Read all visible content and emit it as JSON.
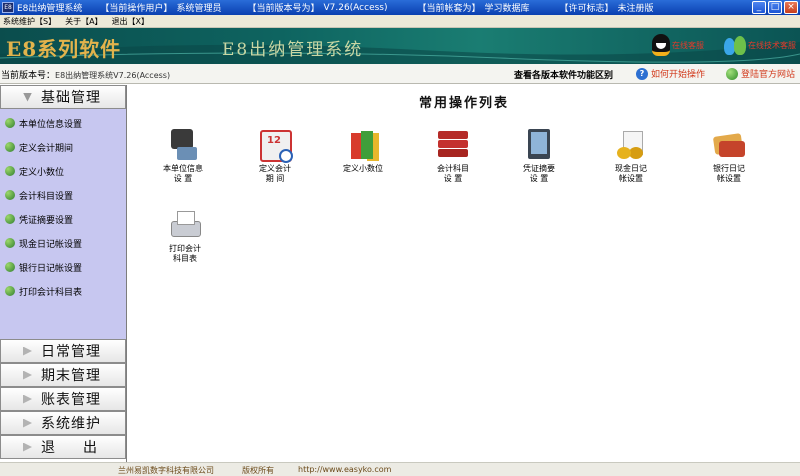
{
  "titlebar": {
    "icon_text": "E8",
    "app_name": "E8出纳管理系统",
    "operator_label": "【当前操作用户】",
    "operator_value": "系统管理员",
    "version_label": "【当前版本号为】",
    "version_value": "V7.26(Access)",
    "account_label": "【当前帐套为】",
    "account_value": "学习数据库",
    "license_label": "【许可标志】",
    "license_value": "未注册版"
  },
  "menu": {
    "items": [
      "系统维护【S】",
      "关于【A】",
      "退出【X】"
    ]
  },
  "banner": {
    "brand": "E8系列软件",
    "product": "E8出纳管理系统",
    "qq1": "在线客服",
    "qq2": "在线技术客服"
  },
  "infobar": {
    "version_label": "当前版本号：",
    "version_value": "E8出纳管理系统V7.26(Access)",
    "compare": "查看各版本软件功能区别",
    "help": "如何开始操作",
    "site": "登陆官方网站"
  },
  "nav": {
    "basic": "基础管理",
    "items": [
      "本单位信息设置",
      "定义会计期间",
      "定义小数位",
      "会计科目设置",
      "凭证摘要设置",
      "现金日记帐设置",
      "银行日记帐设置",
      "打印会计科目表"
    ],
    "daily": "日常管理",
    "period_end": "期末管理",
    "ledger": "账表管理",
    "system": "系统维护",
    "exit": "退出"
  },
  "main": {
    "title": "常用操作列表",
    "ops": [
      "本单位信息\n设  置",
      "定义会计\n期  间",
      "定义小数位",
      "会计科目\n设  置",
      "凭证摘要\n设  置",
      "现金日记\n帐设置",
      "银行日记\n帐设置",
      "打印会计\n科目表"
    ]
  },
  "footer": {
    "company": "兰州易凯数字科技有限公司",
    "rights": "版权所有",
    "http": "http://www.easyko.com"
  }
}
